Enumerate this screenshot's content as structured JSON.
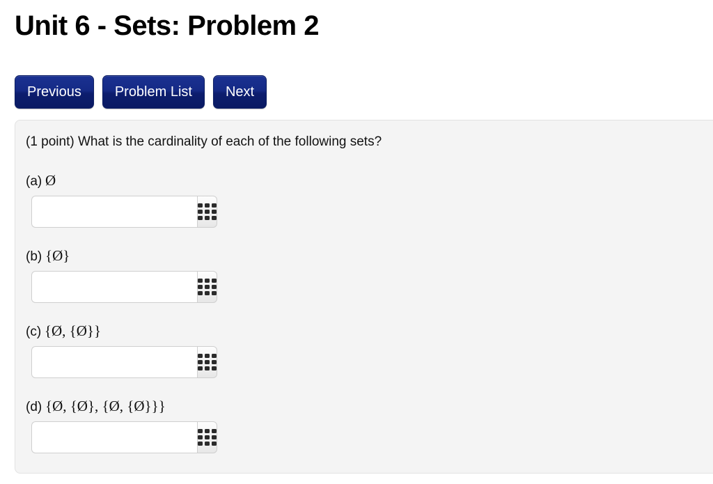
{
  "page": {
    "title": "Unit 6 - Sets: Problem 2"
  },
  "nav": {
    "previous_label": "Previous",
    "problem_list_label": "Problem List",
    "next_label": "Next"
  },
  "problem": {
    "question": "(1 point) What is the cardinality of each of the following sets?",
    "parts": [
      {
        "tag": "(a)",
        "expression": "Ø",
        "answer_value": "",
        "keypad_icon": "math-keypad-icon"
      },
      {
        "tag": "(b)",
        "expression": "{Ø}",
        "answer_value": "",
        "keypad_icon": "math-keypad-icon"
      },
      {
        "tag": "(c)",
        "expression": "{Ø, {Ø}}",
        "answer_value": "",
        "keypad_icon": "math-keypad-icon"
      },
      {
        "tag": "(d)",
        "expression": "{Ø, {Ø}, {Ø, {Ø}}}",
        "answer_value": "",
        "keypad_icon": "math-keypad-icon"
      }
    ]
  },
  "colors": {
    "button_navy": "#152a86",
    "panel_background": "#f4f4f4",
    "panel_border": "#e2e2e2",
    "input_border": "#cfcfcf",
    "keypad_dot": "#2b2b2b"
  }
}
